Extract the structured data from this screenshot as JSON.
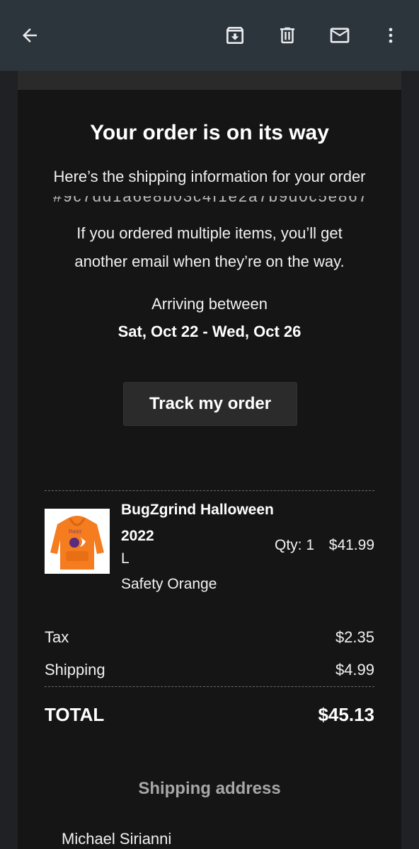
{
  "appbar": {
    "back_icon": "arrow-back-icon",
    "archive_icon": "archive-icon",
    "delete_icon": "delete-icon",
    "mail_icon": "mark-unread-icon",
    "more_icon": "more-vertical-icon"
  },
  "email": {
    "title": "Your order is on its way",
    "shipping_info": "Here’s the shipping information for your order",
    "order_id_redacted": "#9c7dd1a6e8b03c4f1e2a7b9d0c5e867b",
    "multi_line1": "If you ordered multiple items, you’ll get",
    "multi_line2": "another email when they’re on the way.",
    "arriving_label": "Arriving between",
    "arriving_dates": "Sat, Oct 22 - Wed, Oct 26",
    "track_button": "Track my order"
  },
  "item": {
    "name": "BugZgrind Halloween 2022",
    "size": "L",
    "color": "Safety Orange",
    "qty": "Qty: 1",
    "price": "$41.99",
    "thumb_text": "Happy"
  },
  "summary": {
    "tax_label": "Tax",
    "tax_value": "$2.35",
    "shipping_label": "Shipping",
    "shipping_value": "$4.99",
    "total_label": "TOTAL",
    "total_value": "$45.13"
  },
  "shipping_address": {
    "header": "Shipping address",
    "name": "Michael Sirianni"
  },
  "colors": {
    "appbar": "#2d353c",
    "email_bg": "#151515",
    "product_orange": "#f57c1f"
  }
}
